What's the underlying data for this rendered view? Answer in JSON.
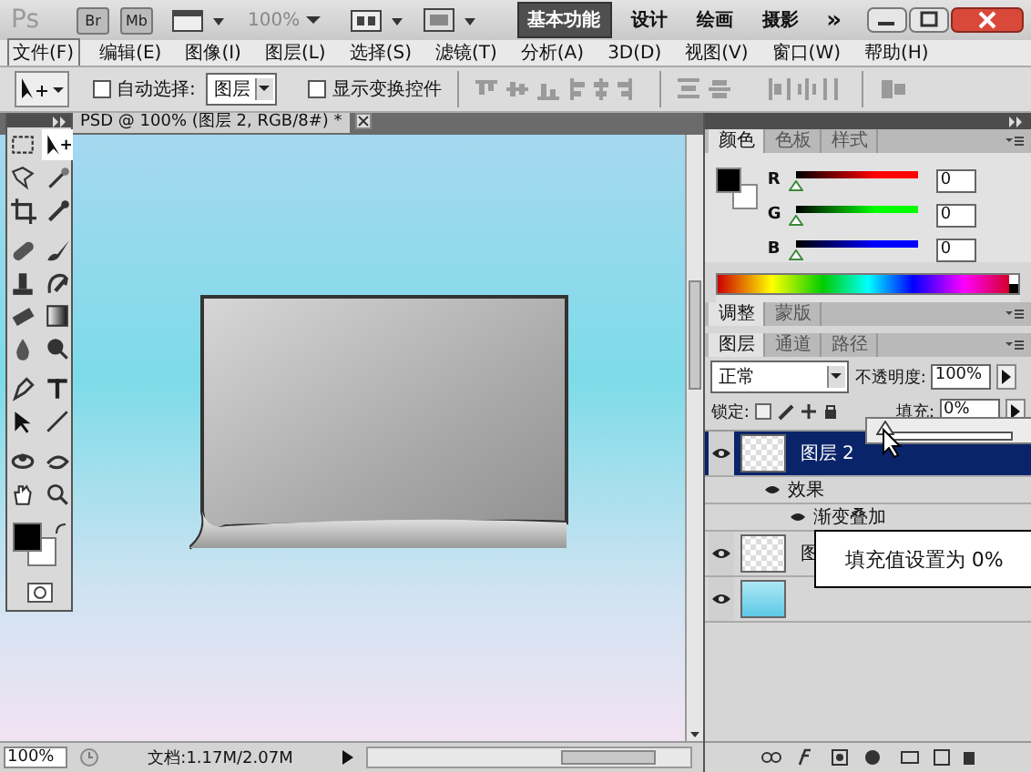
{
  "app": {
    "logo": "Ps",
    "bridge": "Br",
    "mini_bridge": "Mb",
    "zoom": "100%"
  },
  "workspaces": [
    {
      "label": "基本功能",
      "selected": true
    },
    {
      "label": "设计",
      "selected": false
    },
    {
      "label": "绘画",
      "selected": false
    },
    {
      "label": "摄影",
      "selected": false
    }
  ],
  "more": "»",
  "menu": [
    {
      "label": "文件(F)",
      "selected": true
    },
    {
      "label": "编辑(E)",
      "selected": false
    },
    {
      "label": "图像(I)",
      "selected": false
    },
    {
      "label": "图层(L)",
      "selected": false
    },
    {
      "label": "选择(S)",
      "selected": false
    },
    {
      "label": "滤镜(T)",
      "selected": false
    },
    {
      "label": "分析(A)",
      "selected": false
    },
    {
      "label": "3D(D)",
      "selected": false
    },
    {
      "label": "视图(V)",
      "selected": false
    },
    {
      "label": "窗口(W)",
      "selected": false
    },
    {
      "label": "帮助(H)",
      "selected": false
    }
  ],
  "options": {
    "auto_select": {
      "label": "自动选择:",
      "checked": false
    },
    "target": "图层",
    "show_transform": {
      "label": "显示变换控件",
      "checked": false
    }
  },
  "document": {
    "tab": "PSD @ 100% (图层 2, RGB/8#) *"
  },
  "status": {
    "zoom": "100%",
    "doc_size": "文档:1.17M/2.07M"
  },
  "color_panel": {
    "tabs": [
      {
        "label": "颜色",
        "selected": true
      },
      {
        "label": "色板",
        "selected": false
      },
      {
        "label": "样式",
        "selected": false
      }
    ],
    "channels": [
      {
        "name": "R",
        "value": "0",
        "level": 0,
        "color": "#ff0000"
      },
      {
        "name": "G",
        "value": "0",
        "level": 0,
        "color": "#00ff00"
      },
      {
        "name": "B",
        "value": "0",
        "level": 0,
        "color": "#0000ff"
      }
    ]
  },
  "adjust_panel": {
    "tabs": [
      {
        "label": "调整",
        "selected": true
      },
      {
        "label": "蒙版",
        "selected": false
      }
    ]
  },
  "layers_panel": {
    "tabs": [
      {
        "label": "图层",
        "selected": true
      },
      {
        "label": "通道",
        "selected": false
      },
      {
        "label": "路径",
        "selected": false
      }
    ],
    "blend_mode": "正常",
    "opacity_label": "不透明度:",
    "opacity": "100%",
    "lock_label": "锁定:",
    "fill_label": "填充:",
    "fill": "0%",
    "fill_slider": {
      "level": 0
    },
    "layers": [
      {
        "kind": "layer",
        "name": "图层 2",
        "selected": true,
        "transparent": true
      },
      {
        "kind": "effects",
        "name": "效果"
      },
      {
        "kind": "effect",
        "name": "渐变叠加"
      },
      {
        "kind": "layer",
        "name": "图",
        "selected": false,
        "transparent": true
      },
      {
        "kind": "layer",
        "selected": false,
        "transparent": false
      }
    ]
  },
  "tooltip": "填充值设置为 0%"
}
